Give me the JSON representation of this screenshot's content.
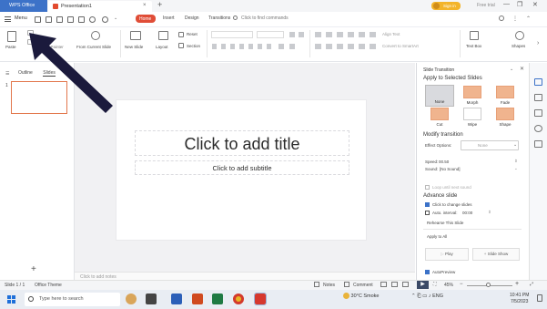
{
  "titlebar": {
    "wps_tab": "WPS Office",
    "doc_tab": "Presentation1",
    "close_glyph": "×",
    "new_tab_glyph": "+",
    "signin": "Sign in",
    "free_trial": "Free trial",
    "window_controls": [
      "—",
      "❐",
      "✕"
    ]
  },
  "menubar": {
    "menu_label": "Menu",
    "tabs": [
      "Home",
      "Insert",
      "Design",
      "Transitions"
    ],
    "active_tab": "Home",
    "find_placeholder": "Click to find commands"
  },
  "ribbon": {
    "paste": "Paste",
    "format_painter": "Format Painter",
    "current_slide": "From Current Slide",
    "new_slide": "New Slide",
    "layout": "Layout",
    "reset": "Reset",
    "section": "Section",
    "text_box": "Text Box",
    "shapes": "Shapes",
    "align_text": "Align Text",
    "convert_smartart": "Convert to SmartArt"
  },
  "left_pane": {
    "tabs": [
      "Outline",
      "Slides"
    ],
    "slide_number": "1",
    "add_glyph": "+"
  },
  "slide": {
    "title_placeholder": "Click to add title",
    "subtitle_placeholder": "Click to add subtitle"
  },
  "notes_placeholder": "Click to add notes",
  "transition_panel": {
    "header": "Slide Transition",
    "apply_section": "Apply to Selected Slides",
    "transitions": [
      "None",
      "Morph",
      "Fade",
      "Cut",
      "Wipe",
      "Shape"
    ],
    "modify_section": "Modify transition",
    "effect_options_label": "Effect Options:",
    "effect_options_value": "None",
    "speed_label": "Speed:",
    "speed_value": "00.50",
    "sound_label": "Sound:",
    "sound_value": "[No Sound]",
    "loop_label": "Loop until next sound",
    "advance_section": "Advance slide",
    "click_change": "Click to change slides",
    "auto_interval_label": "Auto. interval:",
    "auto_interval_value": "00:00",
    "rehearse": "Rehearse This Slide",
    "apply_all": "Apply to All",
    "play": "Play",
    "slide_show": "Slide Show",
    "autopreview": "AutoPreview"
  },
  "statusbar": {
    "slide_count": "Slide 1 / 1",
    "theme": "Office Theme",
    "notes": "Notes",
    "comment": "Comment",
    "zoom": "45%"
  },
  "taskbar": {
    "search_placeholder": "Type here to search",
    "weather": "30°C Smoke",
    "language": "ENG",
    "time": "10:41 PM",
    "date": "7/5/2023"
  },
  "colors": {
    "accent_red": "#e04d37",
    "wps_blue": "#3c72c8",
    "transition_orange": "#f0b48e",
    "arrow": "#1b1a3c"
  }
}
